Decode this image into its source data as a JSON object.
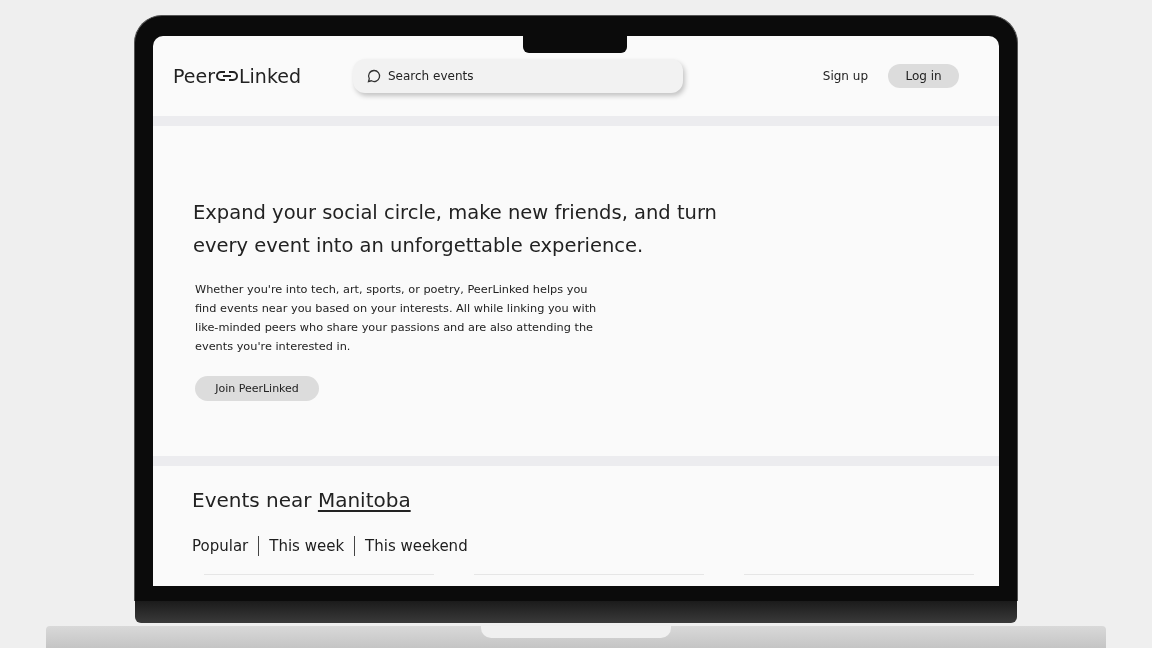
{
  "header": {
    "logo": {
      "left": "Peer",
      "right": "Linked"
    },
    "search": {
      "placeholder": "Search events"
    },
    "sign_up": "Sign up",
    "log_in": "Log in"
  },
  "hero": {
    "heading": "Expand your social circle, make new friends, and turn every event into an unforgettable experience.",
    "body": "Whether you're into tech, art, sports, or poetry, PeerLinked helps you find events near you based on your interests. All while linking you with like-minded peers who share your passions and are also attending the events you're interested in.",
    "button": "Join PeerLinked"
  },
  "events": {
    "heading": "Events near",
    "location": "Manitoba",
    "tabs": [
      {
        "label": "Popular"
      },
      {
        "label": "This week"
      },
      {
        "label": "This weekend"
      }
    ]
  }
}
